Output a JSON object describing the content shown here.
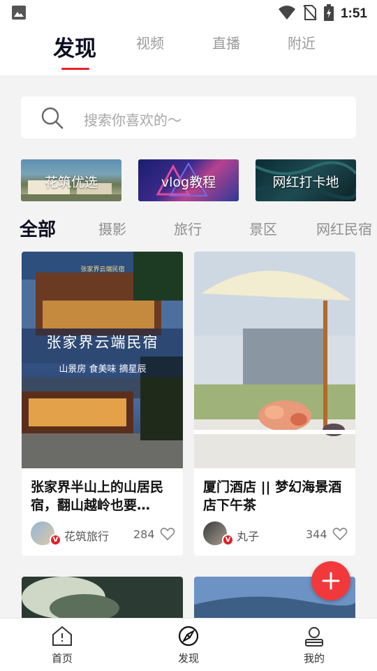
{
  "status_bar": {
    "time": "1:51"
  },
  "top_tabs": [
    {
      "label": "发现",
      "active": true
    },
    {
      "label": "视频",
      "active": false
    },
    {
      "label": "直播",
      "active": false
    },
    {
      "label": "附近",
      "active": false
    }
  ],
  "search": {
    "placeholder": "搜索你喜欢的～"
  },
  "banners": [
    {
      "label": "花筑优选"
    },
    {
      "label": "vlog教程"
    },
    {
      "label": "网红打卡地"
    }
  ],
  "categories": [
    {
      "label": "全部",
      "active": true
    },
    {
      "label": "摄影"
    },
    {
      "label": "旅行"
    },
    {
      "label": "景区"
    },
    {
      "label": "网红民宿"
    }
  ],
  "cards": [
    {
      "image_text": {
        "headline": "张家界云端民宿",
        "sub": "山景房 食美味 摘星辰",
        "sign": "张家界云端民宿"
      },
      "title": "张家界半山上的山居民宿，翻山越岭也要…",
      "author": "花筑旅行",
      "verified_badge": "V",
      "likes": "284"
    },
    {
      "title": "厦门酒店 || 梦幻海景酒店下午茶",
      "author": "丸子",
      "verified_badge": "V",
      "likes": "344"
    }
  ],
  "bottom_nav": [
    {
      "label": "首页",
      "icon": "home-icon"
    },
    {
      "label": "发现",
      "icon": "discover-icon"
    },
    {
      "label": "我的",
      "icon": "profile-icon"
    }
  ],
  "colors": {
    "accent": "#e8222b",
    "fab": "#f1393c",
    "title": "#0e0e23"
  }
}
